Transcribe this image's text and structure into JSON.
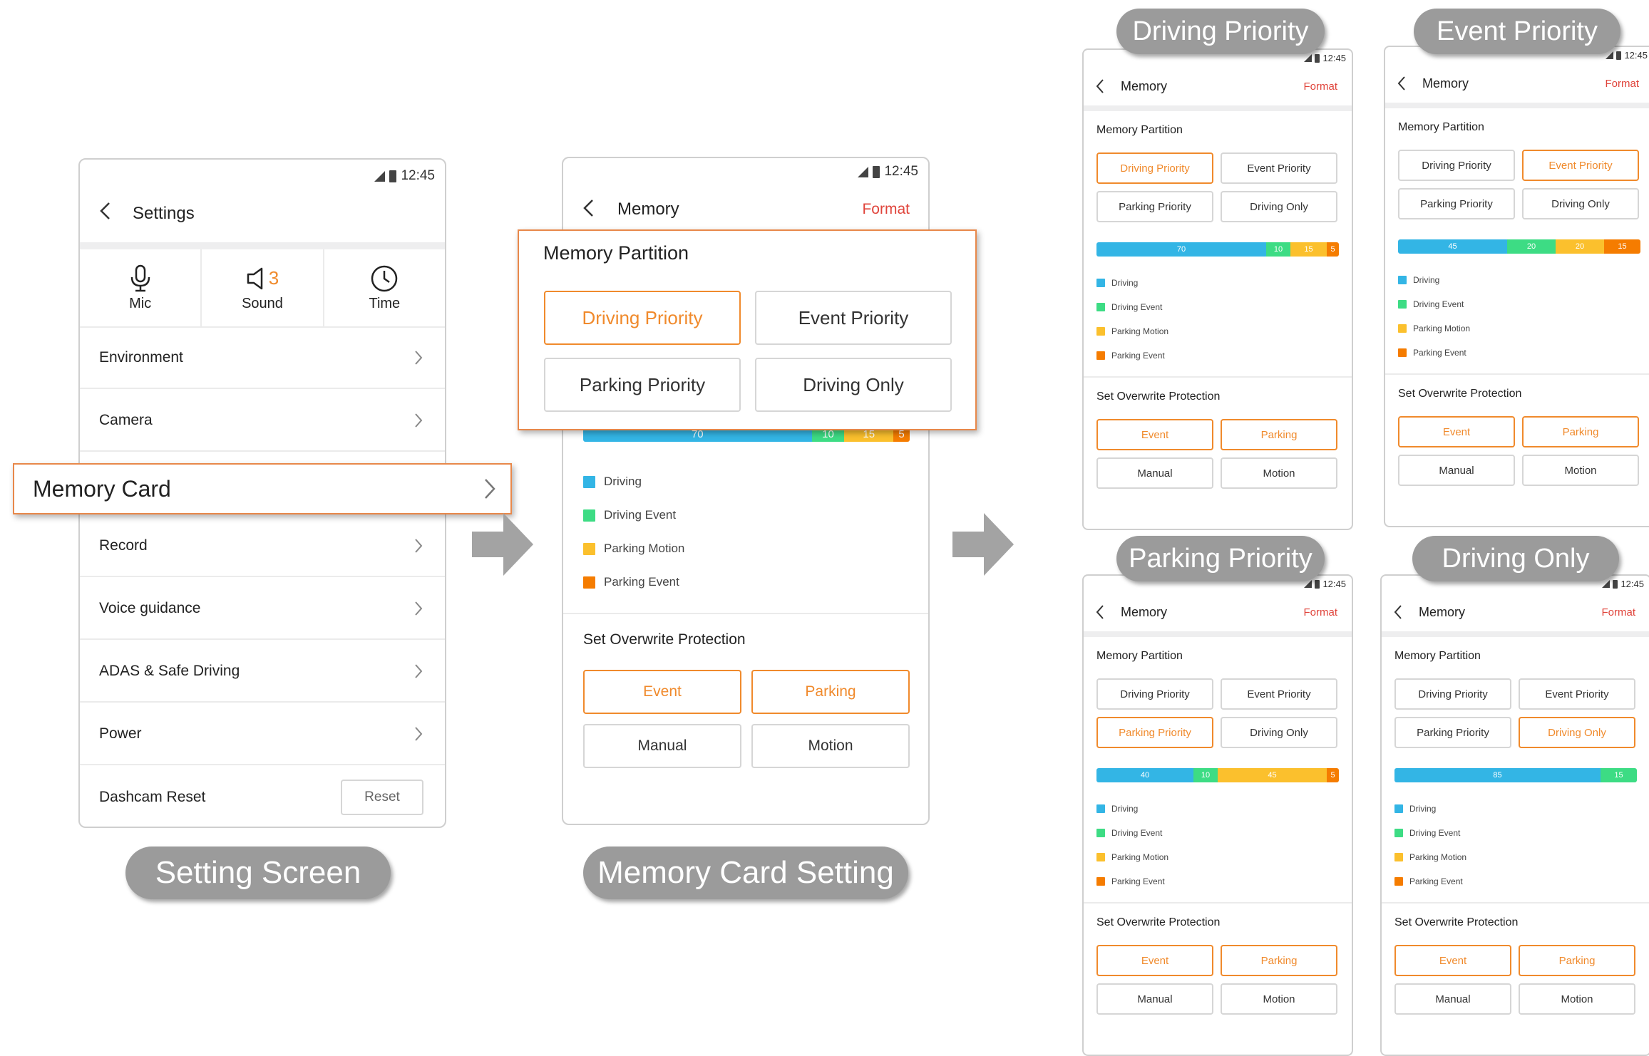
{
  "status": {
    "time": "12:45"
  },
  "settings_screen": {
    "title": "Settings",
    "quick": [
      {
        "label": "Mic",
        "icon": "mic-icon"
      },
      {
        "label": "Sound",
        "icon": "speaker-icon",
        "badge": "3"
      },
      {
        "label": "Time",
        "icon": "clock-icon"
      }
    ],
    "items": [
      "Environment",
      "Camera",
      "Memory Card",
      "Record",
      "Voice guidance",
      "ADAS & Safe Driving",
      "Power"
    ],
    "reset_row": {
      "label": "Dashcam Reset",
      "button": "Reset"
    },
    "caption": "Setting Screen"
  },
  "memory_screen": {
    "title": "Memory",
    "format": "Format",
    "partition_title": "Memory Partition",
    "options": [
      "Driving Priority",
      "Event Priority",
      "Parking Priority",
      "Driving Only"
    ],
    "legend": [
      "Driving",
      "Driving Event",
      "Parking Motion",
      "Parking Event"
    ],
    "overwrite_title": "Set Overwrite Protection",
    "overwrite_options": [
      "Event",
      "Parking",
      "Manual",
      "Motion"
    ],
    "caption": "Memory Card Setting"
  },
  "colors": {
    "accent": "#f08a2c",
    "driving": "#33b5e5",
    "driving_event": "#3ddc84",
    "parking_motion": "#fbc02d",
    "parking_event": "#f57c00",
    "format": "#e0443b",
    "pill": "#9b9b9b"
  },
  "variants": [
    {
      "label": "Driving Priority",
      "selected": 0,
      "bar": [
        70,
        10,
        15,
        5
      ]
    },
    {
      "label": "Event Priority",
      "selected": 1,
      "bar": [
        45,
        20,
        20,
        15
      ]
    },
    {
      "label": "Parking Priority",
      "selected": 2,
      "bar": [
        40,
        10,
        45,
        5
      ]
    },
    {
      "label": "Driving Only",
      "selected": 3,
      "bar": [
        85,
        15,
        0,
        0
      ]
    }
  ],
  "middle": {
    "selected": 0,
    "bar": [
      70,
      10,
      15,
      5
    ]
  }
}
